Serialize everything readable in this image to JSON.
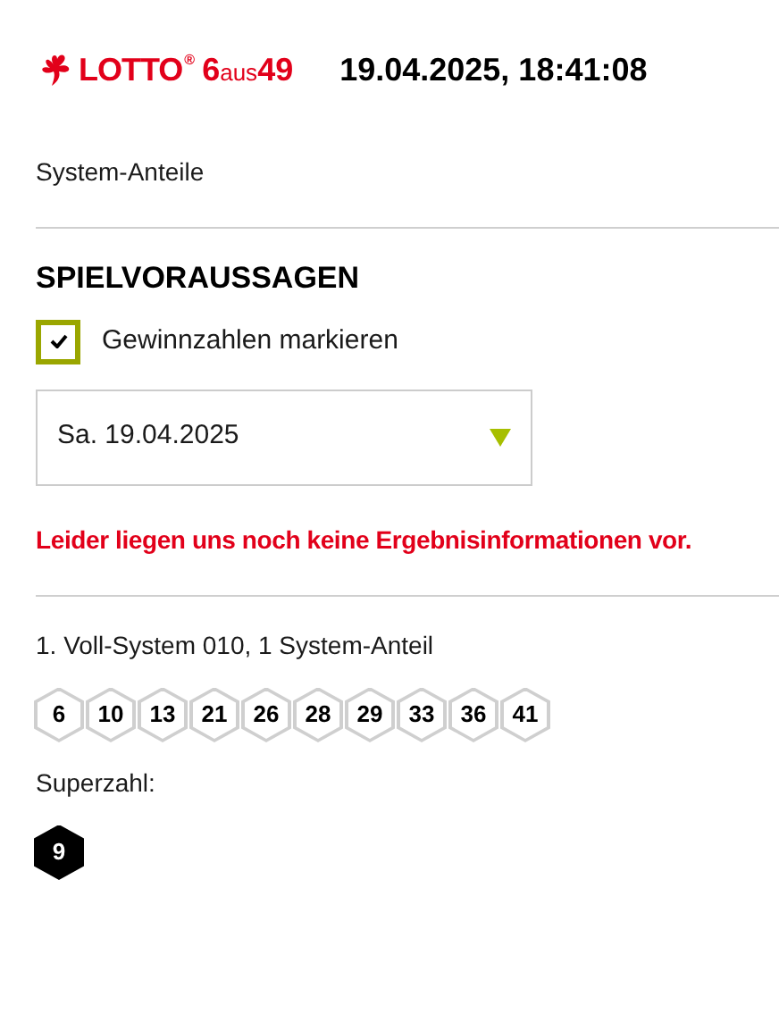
{
  "header": {
    "logo": {
      "word": "LOTTO",
      "registered": "®",
      "number": "6",
      "joiner": "aus",
      "total": "49"
    },
    "datetime": "19.04.2025, 18:41:08"
  },
  "subtitle": "System-Anteile",
  "section": {
    "title": "SPIELVORAUSSAGEN",
    "checkbox": {
      "label": "Gewinnzahlen markieren",
      "checked": true
    },
    "date_select": {
      "value": "Sa. 19.04.2025"
    },
    "message": "Leider liegen uns noch keine Ergebnisinformationen vor."
  },
  "ticket": {
    "title": "1. Voll-System 010, 1 System-Anteil",
    "numbers": [
      "6",
      "10",
      "13",
      "21",
      "26",
      "28",
      "29",
      "33",
      "36",
      "41"
    ],
    "superzahl_label": "Superzahl:",
    "superzahl": "9"
  }
}
